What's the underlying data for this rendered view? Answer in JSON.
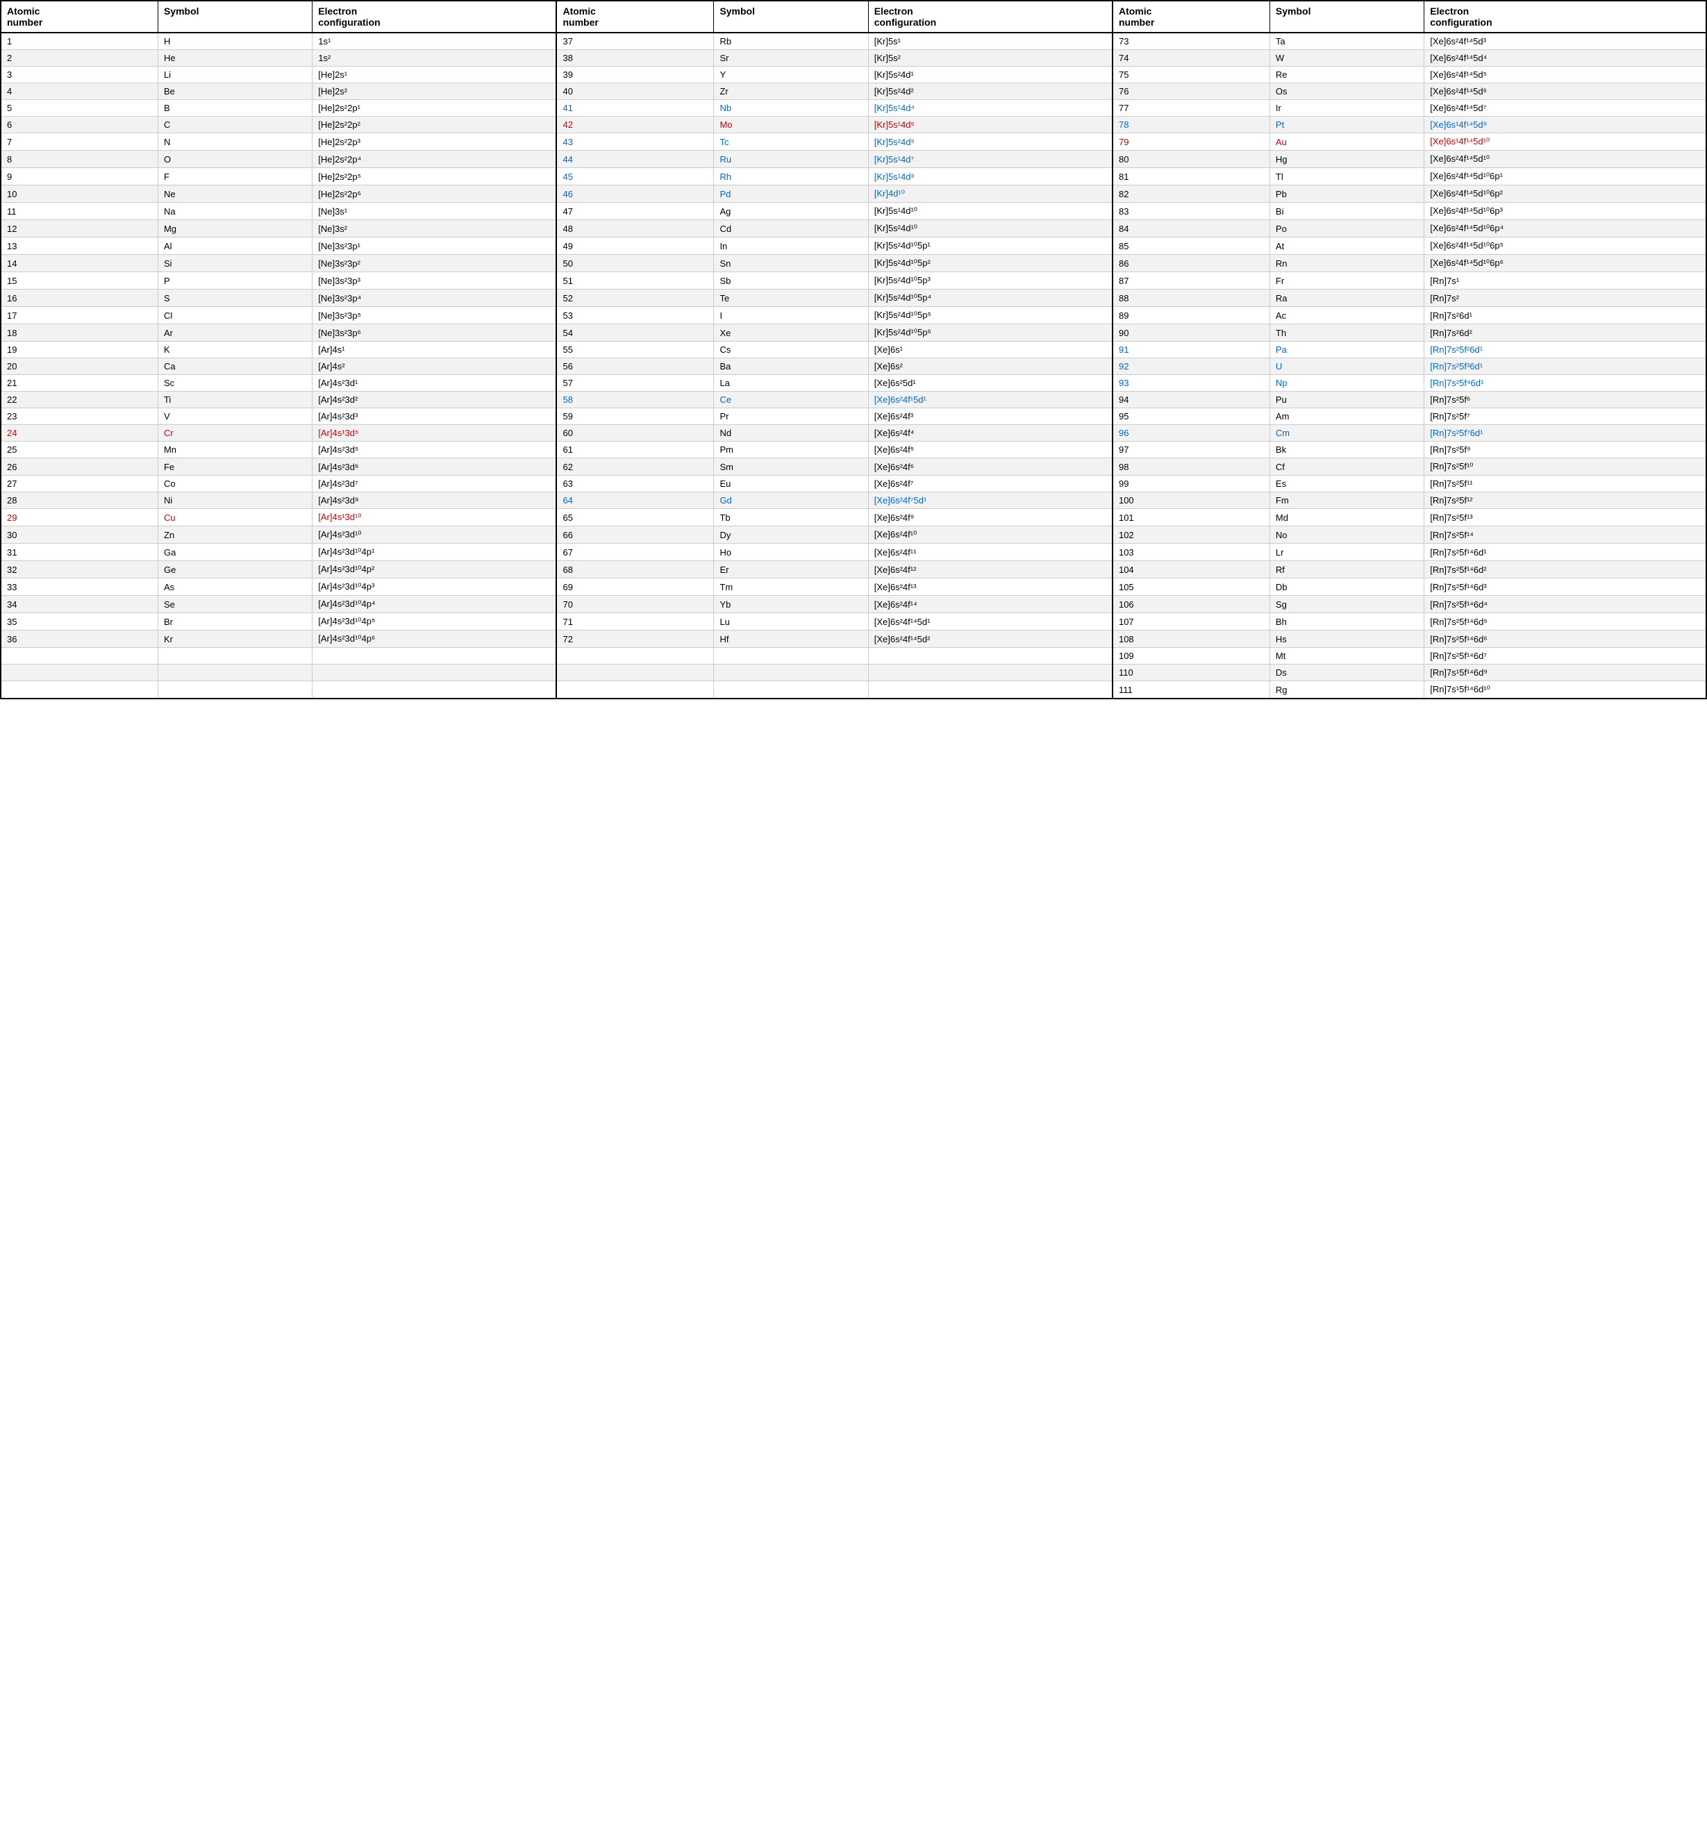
{
  "headers": [
    {
      "col1": "Atomic number",
      "col2": "Symbol",
      "col3": "Electron configuration"
    },
    {
      "col1": "Atomic number",
      "col2": "Symbol",
      "col3": "Electron configuration"
    },
    {
      "col1": "Atomic number",
      "col2": "Symbol",
      "col3": "Electron configuration"
    }
  ],
  "rows": [
    {
      "n1": "1",
      "s1": "H",
      "e1": "1s¹",
      "n2": "37",
      "s2": "Rb",
      "e2": "[Kr]5s¹",
      "n3": "73",
      "s3": "Ta",
      "e3": "[Xe]6s²4f¹⁴5d³",
      "c1": "",
      "c2": "",
      "c3": ""
    },
    {
      "n1": "2",
      "s1": "He",
      "e1": "1s²",
      "n2": "38",
      "s2": "Sr",
      "e2": "[Kr]5s²",
      "n3": "74",
      "s3": "W",
      "e3": "[Xe]6s²4f¹⁴5d⁴",
      "c1": "",
      "c2": "",
      "c3": ""
    },
    {
      "n1": "3",
      "s1": "Li",
      "e1": "[He]2s¹",
      "n2": "39",
      "s2": "Y",
      "e2": "[Kr]5s²4d¹",
      "n3": "75",
      "s3": "Re",
      "e3": "[Xe]6s²4f¹⁴5d⁵",
      "c1": "",
      "c2": "",
      "c3": ""
    },
    {
      "n1": "4",
      "s1": "Be",
      "e1": "[He]2s²",
      "n2": "40",
      "s2": "Zr",
      "e2": "[Kr]5s²4d²",
      "n3": "76",
      "s3": "Os",
      "e3": "[Xe]6s²4f¹⁴5d⁶",
      "c1": "",
      "c2": "",
      "c3": ""
    },
    {
      "n1": "5",
      "s1": "B",
      "e1": "[He]2s²2p¹",
      "n2": "41",
      "s2": "Nb",
      "e2": "[Kr]5s¹4d⁴",
      "n3": "77",
      "s3": "Ir",
      "e3": "[Xe]6s²4f¹⁴5d⁷",
      "c1": "",
      "c2": "blue",
      "c3": "blue"
    },
    {
      "n1": "6",
      "s1": "C",
      "e1": "[He]2s²2p²",
      "n2": "42",
      "s2": "Mo",
      "e2": "[Kr]5s¹4d⁵",
      "n3": "78",
      "s3": "Pt",
      "e3": "[Xe]6s¹4f¹⁴5d⁹",
      "c1": "",
      "c2": "red",
      "c3": "red",
      "cn3": "blue"
    },
    {
      "n1": "7",
      "s1": "N",
      "e1": "[He]2s²2p³",
      "n2": "43",
      "s2": "Tc",
      "e2": "[Kr]5s²4d⁵",
      "n3": "79",
      "s3": "Au",
      "e3": "[Xe]6s¹4f¹⁴5d¹⁰",
      "c1": "",
      "c2": "blue",
      "c3": "blue",
      "cn3": "red",
      "cs3": "red",
      "ce3": "red"
    },
    {
      "n1": "8",
      "s1": "O",
      "e1": "[He]2s²2p⁴",
      "n2": "44",
      "s2": "Ru",
      "e2": "[Kr]5s¹4d⁷",
      "n3": "80",
      "s3": "Hg",
      "e3": "[Xe]6s²4f¹⁴5d¹⁰",
      "c1": "",
      "c2": "blue",
      "c3": "blue"
    },
    {
      "n1": "9",
      "s1": "F",
      "e1": "[He]2s²2p⁵",
      "n2": "45",
      "s2": "Rh",
      "e2": "[Kr]5s¹4d⁸",
      "n3": "81",
      "s3": "Tl",
      "e3": "[Xe]6s²4f¹⁴5d¹⁰6p¹",
      "c1": "",
      "c2": "blue",
      "c3": "blue"
    },
    {
      "n1": "10",
      "s1": "Ne",
      "e1": "[He]2s²2p⁶",
      "n2": "46",
      "s2": "Pd",
      "e2": "[Kr]4d¹⁰",
      "n3": "82",
      "s3": "Pb",
      "e3": "[Xe]6s²4f¹⁴5d¹⁰6p²",
      "c1": "",
      "c2": "blue",
      "c3": "blue"
    },
    {
      "n1": "11",
      "s1": "Na",
      "e1": "[Ne]3s¹",
      "n2": "47",
      "s2": "Ag",
      "e2": "[Kr]5s¹4d¹⁰",
      "n3": "83",
      "s3": "Bi",
      "e3": "[Xe]6s²4f¹⁴5d¹⁰6p³"
    },
    {
      "n1": "12",
      "s1": "Mg",
      "e1": "[Ne]3s²",
      "n2": "48",
      "s2": "Cd",
      "e2": "[Kr]5s²4d¹⁰",
      "n3": "84",
      "s3": "Po",
      "e3": "[Xe]6s²4f¹⁴5d¹⁰6p⁴"
    },
    {
      "n1": "13",
      "s1": "Al",
      "e1": "[Ne]3s²3p¹",
      "n2": "49",
      "s2": "In",
      "e2": "[Kr]5s²4d¹⁰5p¹",
      "n3": "85",
      "s3": "At",
      "e3": "[Xe]6s²4f¹⁴5d¹⁰6p⁵"
    },
    {
      "n1": "14",
      "s1": "Si",
      "e1": "[Ne]3s²3p²",
      "n2": "50",
      "s2": "Sn",
      "e2": "[Kr]5s²4d¹⁰5p²",
      "n3": "86",
      "s3": "Rn",
      "e3": "[Xe]6s²4f¹⁴5d¹⁰6p⁶"
    },
    {
      "n1": "15",
      "s1": "P",
      "e1": "[Ne]3s²3p³",
      "n2": "51",
      "s2": "Sb",
      "e2": "[Kr]5s²4d¹⁰5p³",
      "n3": "87",
      "s3": "Fr",
      "e3": "[Rn]7s¹"
    },
    {
      "n1": "16",
      "s1": "S",
      "e1": "[Ne]3s²3p⁴",
      "n2": "52",
      "s2": "Te",
      "e2": "[Kr]5s²4d¹⁰5p⁴",
      "n3": "88",
      "s3": "Ra",
      "e3": "[Rn]7s²"
    },
    {
      "n1": "17",
      "s1": "Cl",
      "e1": "[Ne]3s²3p⁵",
      "n2": "53",
      "s2": "I",
      "e2": "[Kr]5s²4d¹⁰5p⁵",
      "n3": "89",
      "s3": "Ac",
      "e3": "[Rn]7s²6d¹"
    },
    {
      "n1": "18",
      "s1": "Ar",
      "e1": "[Ne]3s²3p⁶",
      "n2": "54",
      "s2": "Xe",
      "e2": "[Kr]5s²4d¹⁰5p⁶",
      "n3": "90",
      "s3": "Th",
      "e3": "[Rn]7s²6d²"
    },
    {
      "n1": "19",
      "s1": "K",
      "e1": "[Ar]4s¹",
      "n2": "55",
      "s2": "Cs",
      "e2": "[Xe]6s¹",
      "n3": "91",
      "s3": "Pa",
      "e3": "[Rn]7s²5f²6d¹",
      "cn3": "blue",
      "cs3": "blue",
      "ce3": "blue"
    },
    {
      "n1": "20",
      "s1": "Ca",
      "e1": "[Ar]4s²",
      "n2": "56",
      "s2": "Ba",
      "e2": "[Xe]6s²",
      "n3": "92",
      "s3": "U",
      "e3": "[Rn]7s²5f³6d¹",
      "cn3": "blue",
      "cs3": "blue",
      "ce3": "blue"
    },
    {
      "n1": "21",
      "s1": "Sc",
      "e1": "[Ar]4s²3d¹",
      "n2": "57",
      "s2": "La",
      "e2": "[Xe]6s²5d¹",
      "n3": "93",
      "s3": "Np",
      "e3": "[Rn]7s²5f⁴6d¹",
      "cn3": "blue",
      "cs3": "blue",
      "ce3": "blue"
    },
    {
      "n1": "22",
      "s1": "Ti",
      "e1": "[Ar]4s²3d²",
      "n2": "58",
      "s2": "Ce",
      "e2": "[Xe]6s²4f¹5d¹",
      "n3": "94",
      "s3": "Pu",
      "e3": "[Rn]7s²5f⁶",
      "cn2": "blue",
      "cs2": "blue",
      "ce2": "blue"
    },
    {
      "n1": "23",
      "s1": "V",
      "e1": "[Ar]4s²3d³",
      "n2": "59",
      "s2": "Pr",
      "e2": "[Xe]6s²4f³",
      "n3": "95",
      "s3": "Am",
      "e3": "[Rn]7s²5f⁷"
    },
    {
      "n1": "24",
      "s1": "Cr",
      "e1": "[Ar]4s¹3d⁵",
      "n2": "60",
      "s2": "Nd",
      "e2": "[Xe]6s²4f⁴",
      "n3": "96",
      "s3": "Cm",
      "e3": "[Rn]7s²5f⁷6d¹",
      "cn1": "red",
      "cs1": "red",
      "ce1": "red",
      "cn3": "blue",
      "cs3": "blue",
      "ce3": "blue"
    },
    {
      "n1": "25",
      "s1": "Mn",
      "e1": "[Ar]4s²3d⁵",
      "n2": "61",
      "s2": "Pm",
      "e2": "[Xe]6s²4f⁵",
      "n3": "97",
      "s3": "Bk",
      "e3": "[Rn]7s²5f⁹"
    },
    {
      "n1": "26",
      "s1": "Fe",
      "e1": "[Ar]4s²3d⁶",
      "n2": "62",
      "s2": "Sm",
      "e2": "[Xe]6s²4f⁶",
      "n3": "98",
      "s3": "Cf",
      "e3": "[Rn]7s²5f¹⁰"
    },
    {
      "n1": "27",
      "s1": "Co",
      "e1": "[Ar]4s²3d⁷",
      "n2": "63",
      "s2": "Eu",
      "e2": "[Xe]6s²4f⁷",
      "n3": "99",
      "s3": "Es",
      "e3": "[Rn]7s²5f¹¹"
    },
    {
      "n1": "28",
      "s1": "Ni",
      "e1": "[Ar]4s²3d⁸",
      "n2": "64",
      "s2": "Gd",
      "e2": "[Xe]6s²4f⁷5d¹",
      "n3": "100",
      "s3": "Fm",
      "e3": "[Rn]7s²5f¹²",
      "cn2": "blue",
      "cs2": "blue",
      "ce2": "blue"
    },
    {
      "n1": "29",
      "s1": "Cu",
      "e1": "[Ar]4s¹3d¹⁰",
      "n2": "65",
      "s2": "Tb",
      "e2": "[Xe]6s²4f⁹",
      "n3": "101",
      "s3": "Md",
      "e3": "[Rn]7s²5f¹³",
      "cn1": "red",
      "cs1": "red",
      "ce1": "red"
    },
    {
      "n1": "30",
      "s1": "Zn",
      "e1": "[Ar]4s²3d¹⁰",
      "n2": "66",
      "s2": "Dy",
      "e2": "[Xe]6s²4f¹⁰",
      "n3": "102",
      "s3": "No",
      "e3": "[Rn]7s²5f¹⁴"
    },
    {
      "n1": "31",
      "s1": "Ga",
      "e1": "[Ar]4s²3d¹⁰4p¹",
      "n2": "67",
      "s2": "Ho",
      "e2": "[Xe]6s²4f¹¹",
      "n3": "103",
      "s3": "Lr",
      "e3": "[Rn]7s²5f¹⁴6d¹"
    },
    {
      "n1": "32",
      "s1": "Ge",
      "e1": "[Ar]4s²3d¹⁰4p²",
      "n2": "68",
      "s2": "Er",
      "e2": "[Xe]6s²4f¹²",
      "n3": "104",
      "s3": "Rf",
      "e3": "[Rn]7s²5f¹⁴6d²"
    },
    {
      "n1": "33",
      "s1": "As",
      "e1": "[Ar]4s²3d¹⁰4p³",
      "n2": "69",
      "s2": "Tm",
      "e2": "[Xe]6s²4f¹³",
      "n3": "105",
      "s3": "Db",
      "e3": "[Rn]7s²5f¹⁴6d³"
    },
    {
      "n1": "34",
      "s1": "Se",
      "e1": "[Ar]4s²3d¹⁰4p⁴",
      "n2": "70",
      "s2": "Yb",
      "e2": "[Xe]6s²4f¹⁴",
      "n3": "106",
      "s3": "Sg",
      "e3": "[Rn]7s²5f¹⁴6d⁴"
    },
    {
      "n1": "35",
      "s1": "Br",
      "e1": "[Ar]4s²3d¹⁰4p⁵",
      "n2": "71",
      "s2": "Lu",
      "e2": "[Xe]6s²4f¹⁴5d¹",
      "n3": "107",
      "s3": "Bh",
      "e3": "[Rn]7s²5f¹⁴6d⁵"
    },
    {
      "n1": "36",
      "s1": "Kr",
      "e1": "[Ar]4s²3d¹⁰4p⁶",
      "n2": "72",
      "s2": "Hf",
      "e2": "[Xe]6s²4f¹⁴5d²",
      "n3": "108",
      "s3": "Hs",
      "e3": "[Rn]7s²5f¹⁴6d⁶"
    },
    {
      "n1": "",
      "s1": "",
      "e1": "",
      "n2": "",
      "s2": "",
      "e2": "",
      "n3": "109",
      "s3": "Mt",
      "e3": "[Rn]7s²5f¹⁴6d⁷"
    },
    {
      "n1": "",
      "s1": "",
      "e1": "",
      "n2": "",
      "s2": "",
      "e2": "",
      "n3": "110",
      "s3": "Ds",
      "e3": "[Rn]7s¹5f¹⁴6d⁹"
    },
    {
      "n1": "",
      "s1": "",
      "e1": "",
      "n2": "",
      "s2": "",
      "e2": "",
      "n3": "111",
      "s3": "Rg",
      "e3": "[Rn]7s¹5f¹⁴6d¹⁰"
    }
  ]
}
